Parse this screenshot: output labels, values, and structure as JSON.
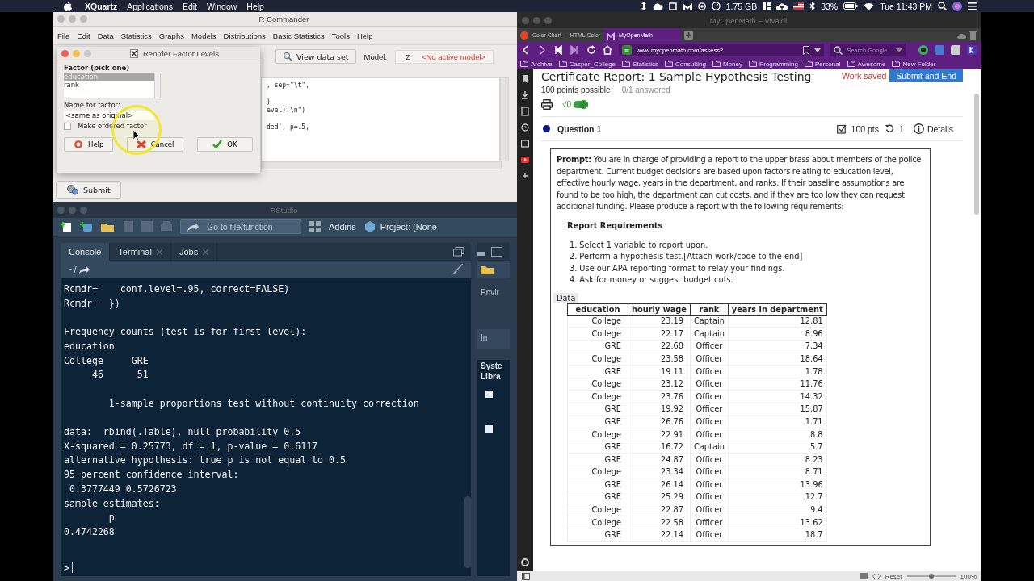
{
  "menubar": {
    "app": "XQuartz",
    "menus": [
      "Applications",
      "Edit",
      "Window",
      "Help"
    ],
    "memory": "1.75 GB",
    "battery": "83%",
    "clock": "Tue 11:43 PM"
  },
  "rcmdr": {
    "title": "R Commander",
    "menus": [
      "File",
      "Edit",
      "Data",
      "Statistics",
      "Graphs",
      "Models",
      "Distributions",
      "Basic Statistics",
      "Tools",
      "Help"
    ],
    "view_button": "View data set",
    "model_label": "Model:",
    "model_symbol": "Σ",
    "model_value": "<No active model>",
    "script_blocks": [
      [
        ", sep=\"\\t\","
      ],
      [
        ")",
        "evel):\\n\")"
      ],
      [
        "ded', p=.5,"
      ]
    ],
    "submit": "Submit"
  },
  "dialog": {
    "title": "Reorder Factor Levels",
    "factor_label": "Factor (pick one)",
    "factors": [
      {
        "label": "education",
        "selected": true
      },
      {
        "label": "rank",
        "selected": false
      }
    ],
    "name_label": "Name for factor:",
    "name_value": "<same as original>",
    "ordered": {
      "label": "Make ordered factor",
      "checked": false
    },
    "buttons": [
      {
        "kind": "help",
        "label": "Help"
      },
      {
        "kind": "cancel",
        "label": "Cancel"
      },
      {
        "kind": "ok",
        "label": "OK"
      }
    ]
  },
  "rstudio": {
    "title": "RStudio",
    "goto": "Go to file/function",
    "addins": "Addins",
    "project": "Project: (None",
    "tabs": [
      {
        "label": "Console",
        "selected": true,
        "closable": false
      },
      {
        "label": "Terminal",
        "selected": false,
        "closable": true
      },
      {
        "label": "Jobs",
        "selected": false,
        "closable": true
      }
    ],
    "path": "~/",
    "console_blocks": [
      [
        "Rcmdr+    conf.level=.95, correct=FALSE)",
        "Rcmdr+  })"
      ],
      [
        "Frequency counts (test is for first level):",
        "education",
        "College     GRE",
        "     46      51"
      ],
      [
        "        1-sample proportions test without continuity correction"
      ],
      [
        "data:  rbind(.Table), null probability 0.5",
        "X-squared = 0.25773, df = 1, p-value = 0.6117",
        "alternative hypothesis: true p is not equal to 0.5",
        "95 percent confidence interval:",
        " 0.3777449 0.5726723",
        "sample estimates:",
        "        p ",
        "0.4742268"
      ]
    ],
    "prompt": ">",
    "side_labels": [
      "Envir",
      "In",
      "Syste",
      "Libra"
    ],
    "package_checks": [
      {
        "checked": false
      },
      {
        "checked": false
      }
    ]
  },
  "browser": {
    "title": "MyOpenMath – Vivaldi",
    "tabs": [
      {
        "label": "Color Chart — HTML Color",
        "selected": false
      },
      {
        "label": "MyOpenMath",
        "selected": true
      }
    ],
    "url": "www.myopenmath.com/assess2",
    "search_placeholder": "Search Google",
    "bookmarks": [
      "Archive",
      "Casper_College",
      "Statistics",
      "Consulting",
      "Money",
      "Programming",
      "Personal",
      "Awesome",
      "New Folder"
    ],
    "page": {
      "title": "Certificate Report: 1 Sample Hypothesis Testing",
      "status": "Work saved",
      "submit": "Submit and End",
      "points": "100 points possible",
      "answered": "0/1 answered",
      "math_toggle": {
        "label": "√0",
        "on": true
      },
      "question": {
        "title": "Question 1",
        "points": "100 pts",
        "tries": "1",
        "details": "Details"
      },
      "prompt": "**Prompt:** You are in charge of providing a report to the upper brass about members of the police department. Current budget decisions are based upon factors relating to education level, effective hourly wage, years in the department, and ranks. If their baseline assumptions are found to be too high, the department can cut costs, and if they are too low they can request additional funding. Please produce a report with the following requirements:",
      "requirements_title": "Report Requirements",
      "requirements": [
        {
          "number": "1.",
          "text": "Select 1 variable to report upon."
        },
        {
          "number": "2.",
          "text": "Perform a hypothesis test.[Attach work/code to the end]"
        },
        {
          "number": "3.",
          "text": "Use our APA reporting format to relay your findings."
        },
        {
          "number": "4.",
          "text": "Ask for money or suggest budget cuts."
        }
      ],
      "data_label": "Data",
      "table": {
        "columns": [
          "education",
          "hourly wage",
          "rank",
          "years in department"
        ],
        "rows": [
          [
            "College",
            "23.19",
            "Captain",
            "12.81"
          ],
          [
            "College",
            "22.17",
            "Captain",
            "8.96"
          ],
          [
            "GRE",
            "22.68",
            "Officer",
            "7.34"
          ],
          [
            "College",
            "23.58",
            "Officer",
            "18.64"
          ],
          [
            "GRE",
            "19.11",
            "Officer",
            "1.78"
          ],
          [
            "College",
            "23.12",
            "Officer",
            "11.76"
          ],
          [
            "College",
            "23.76",
            "Officer",
            "14.32"
          ],
          [
            "GRE",
            "19.92",
            "Officer",
            "15.87"
          ],
          [
            "GRE",
            "26.76",
            "Officer",
            "1.71"
          ],
          [
            "College",
            "22.91",
            "Officer",
            "8.8"
          ],
          [
            "GRE",
            "16.72",
            "Captain",
            "5.7"
          ],
          [
            "GRE",
            "24.87",
            "Officer",
            "8.23"
          ],
          [
            "College",
            "23.34",
            "Officer",
            "8.71"
          ],
          [
            "GRE",
            "26.14",
            "Officer",
            "13.96"
          ],
          [
            "GRE",
            "25.29",
            "Officer",
            "12.7"
          ],
          [
            "College",
            "22.87",
            "Officer",
            "9.4"
          ],
          [
            "College",
            "22.58",
            "Officer",
            "13.62"
          ],
          [
            "GRE",
            "22.14",
            "Officer",
            "18.7"
          ]
        ]
      }
    },
    "status_bar": {
      "reset": "Reset",
      "level": 0.5,
      "zoom": "100%"
    }
  }
}
